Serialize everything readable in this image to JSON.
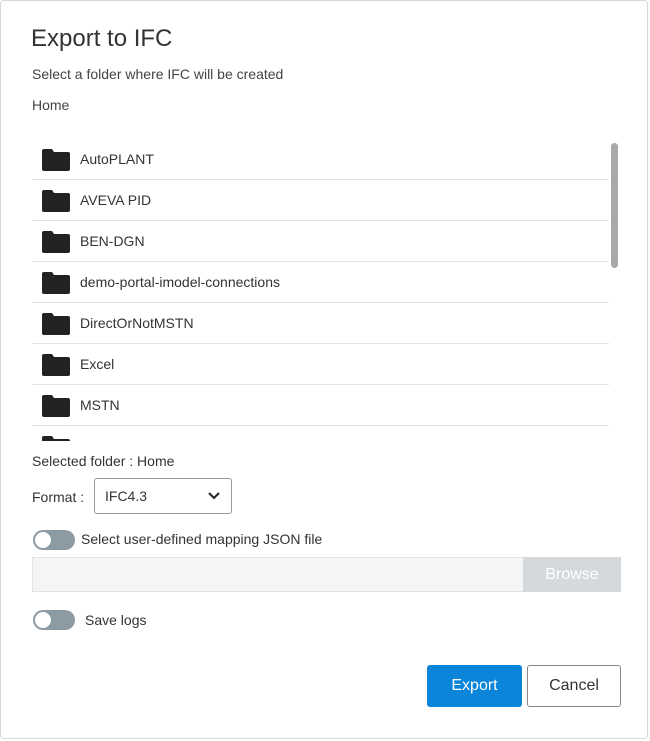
{
  "dialog": {
    "title": "Export to IFC",
    "subtitle": "Select a folder where IFC will be created",
    "breadcrumb": "Home"
  },
  "folders": [
    {
      "label": "AutoPLANT",
      "icon": "folder-icon"
    },
    {
      "label": "AVEVA PID",
      "icon": "folder-icon"
    },
    {
      "label": "BEN-DGN",
      "icon": "folder-icon"
    },
    {
      "label": "demo-portal-imodel-connections",
      "icon": "folder-icon"
    },
    {
      "label": "DirectOrNotMSTN",
      "icon": "folder-icon"
    },
    {
      "label": "Excel",
      "icon": "folder-icon"
    },
    {
      "label": "MSTN",
      "icon": "folder-icon"
    },
    {
      "label": "",
      "icon": "folder-icon"
    }
  ],
  "selected_folder": "Selected folder : Home",
  "format": {
    "label": "Format :",
    "value": "IFC4.3",
    "icon": "chevron-down-icon"
  },
  "mapping": {
    "toggle_label": "Select user-defined mapping JSON file",
    "toggle_on": false,
    "file_value": "",
    "browse_label": "Browse"
  },
  "logs": {
    "toggle_label": "Save logs",
    "toggle_on": false
  },
  "actions": {
    "export_label": "Export",
    "cancel_label": "Cancel"
  },
  "colors": {
    "primary": "#0a85d9",
    "toggle_off": "#8c9aa3",
    "browse_disabled": "#d6d9dc"
  }
}
